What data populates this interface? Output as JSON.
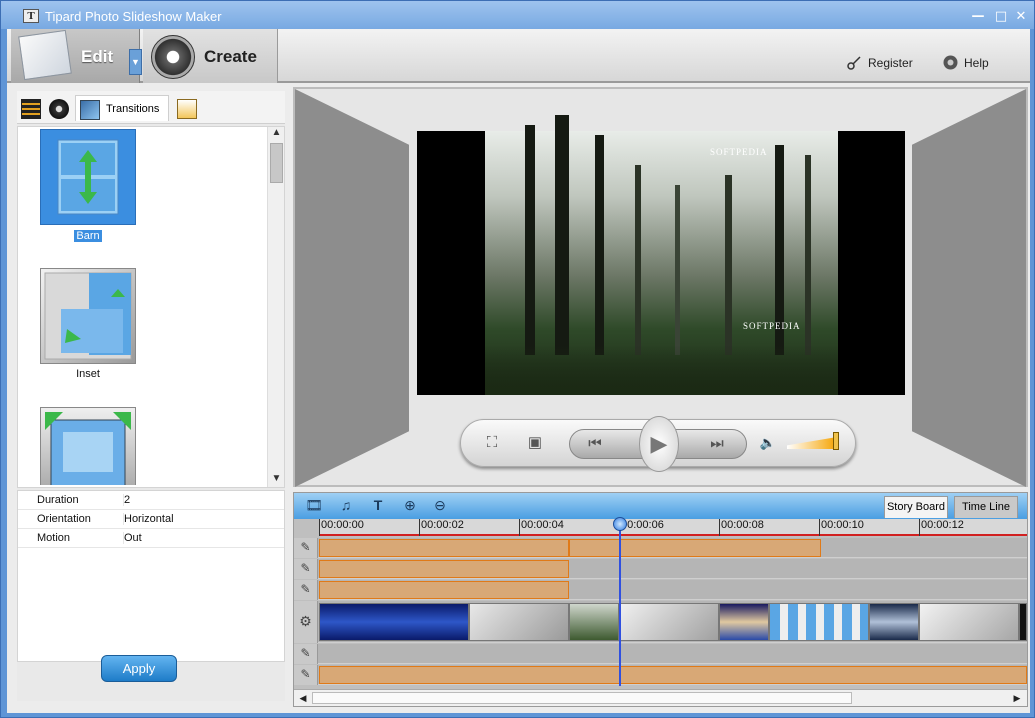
{
  "window": {
    "title": "Tipard Photo Slideshow Maker",
    "icon_letter": "T",
    "minimize": "—",
    "maximize": "□",
    "close": "✕"
  },
  "toolbar": {
    "edit_label": "Edit",
    "dropdown_glyph": "▼",
    "create_label": "Create",
    "register_label": "Register",
    "help_label": "Help"
  },
  "left_tabs": {
    "transitions_label": "Transitions"
  },
  "transitions": [
    {
      "name": "Barn",
      "selected": true
    },
    {
      "name": "Inset",
      "selected": false
    },
    {
      "name": "",
      "selected": false
    }
  ],
  "properties": [
    {
      "key": "Duration",
      "value": "2"
    },
    {
      "key": "Orientation",
      "value": "Horizontal"
    },
    {
      "key": "Motion",
      "value": "Out"
    }
  ],
  "apply_label": "Apply",
  "watermark": "SOFTPEDIA",
  "timeline": {
    "story_board_label": "Story Board",
    "time_line_label": "Time Line",
    "ticks": [
      "00:00:00",
      "00:00:02",
      "00:00:04",
      "00:00:06",
      "00:00:08",
      "00:00:10",
      "00:00:12"
    ],
    "playhead_time_fraction": 0.36
  },
  "colors": {
    "accent": "#1e7cc8",
    "selection": "#3b8ee0",
    "clip": "#d8a876",
    "clip_border": "#e07a18",
    "playhead": "#3050e0"
  }
}
